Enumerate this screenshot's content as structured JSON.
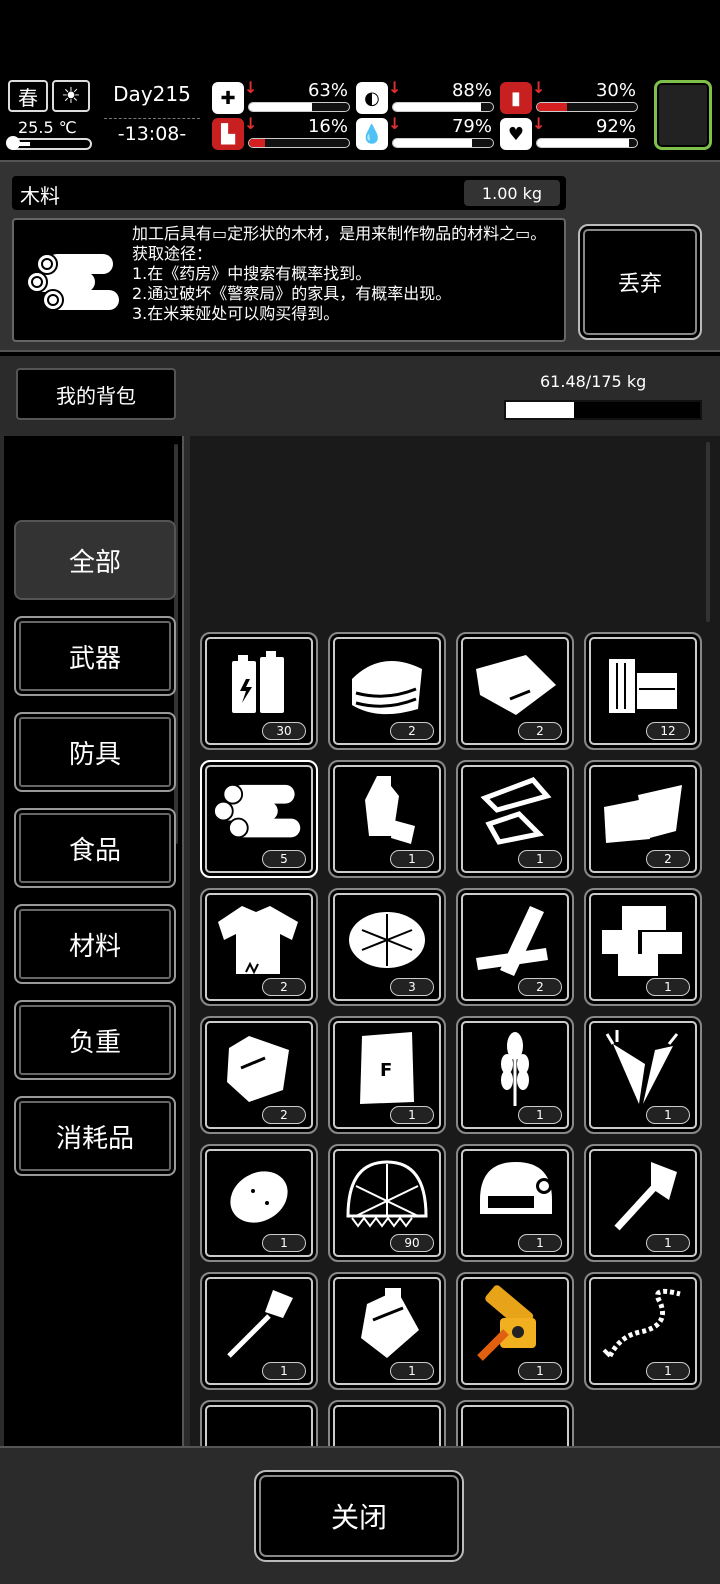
{
  "hud": {
    "season": "春",
    "weather_icon": "sun-icon",
    "temperature": "25.5 ℃",
    "day": "Day215",
    "time": "-13:08-",
    "stats": [
      {
        "name": "health",
        "icon": "medkit-icon",
        "value": "63%",
        "fill": 0.63,
        "red": false
      },
      {
        "name": "hunger",
        "icon": "stomach-icon",
        "value": "88%",
        "fill": 0.88,
        "red": false
      },
      {
        "name": "energy",
        "icon": "battery-icon",
        "value": "30%",
        "fill": 0.3,
        "red": true
      },
      {
        "name": "stamina",
        "icon": "boot-icon",
        "value": "16%",
        "fill": 0.16,
        "red": true
      },
      {
        "name": "thirst",
        "icon": "water-drop-icon",
        "value": "79%",
        "fill": 0.79,
        "red": false
      },
      {
        "name": "mood",
        "icon": "heart-icon",
        "value": "92%",
        "fill": 0.92,
        "red": false
      }
    ]
  },
  "item_info": {
    "name": "木料",
    "weight": "1.00 kg",
    "description": "加工后具有▭定形状的木材，是用来制作物品的材料之▭。\n获取途径：\n1.在《药房》中搜索有概率找到。\n2.通过破坏《警察局》的家具，有概率出现。\n3.在米莱娅处可以购买得到。",
    "discard_label": "丢弃"
  },
  "bag": {
    "title": "我的背包",
    "capacity": "61.48/175 kg",
    "capacity_fill": 0.351
  },
  "categories": [
    "全部",
    "武器",
    "防具",
    "食品",
    "材料",
    "负重",
    "消耗品"
  ],
  "items": [
    {
      "name": "batteries",
      "count": "30"
    },
    {
      "name": "cloth",
      "count": "2"
    },
    {
      "name": "leather",
      "count": "2"
    },
    {
      "name": "planks",
      "count": "12"
    },
    {
      "name": "logs",
      "count": "5",
      "selected": true
    },
    {
      "name": "plastic-bottle",
      "count": "1"
    },
    {
      "name": "scrap-metal",
      "count": "1"
    },
    {
      "name": "fabric-sheets",
      "count": "2"
    },
    {
      "name": "torn-shirt",
      "count": "2"
    },
    {
      "name": "straw-bundle",
      "count": "3"
    },
    {
      "name": "broken-boards",
      "count": "2"
    },
    {
      "name": "wood-blocks",
      "count": "1"
    },
    {
      "name": "stone",
      "count": "2"
    },
    {
      "name": "flour-bag",
      "count": "1"
    },
    {
      "name": "wheat",
      "count": "1"
    },
    {
      "name": "carrots",
      "count": "1"
    },
    {
      "name": "potato",
      "count": "1"
    },
    {
      "name": "net-helmet",
      "count": "90"
    },
    {
      "name": "tactical-helmet",
      "count": "1"
    },
    {
      "name": "axe",
      "count": "1"
    },
    {
      "name": "shovel",
      "count": "1"
    },
    {
      "name": "backpack-case",
      "count": "1"
    },
    {
      "name": "chainsaw",
      "count": "1"
    },
    {
      "name": "rope",
      "count": "1"
    }
  ],
  "close_label": "关闭"
}
